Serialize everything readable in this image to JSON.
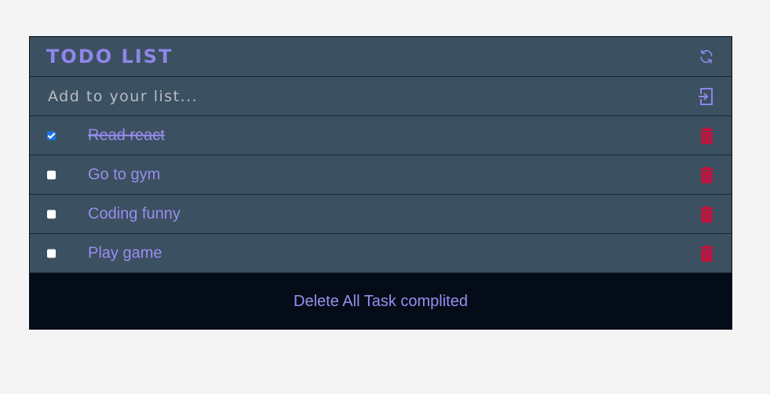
{
  "header": {
    "title": "TODO LIST",
    "refresh_icon": "refresh-icon"
  },
  "add_form": {
    "placeholder": "Add to your list...",
    "value": "",
    "submit_icon": "sign-in-icon"
  },
  "tasks": [
    {
      "label": "Read react",
      "completed": true
    },
    {
      "label": "Go to gym",
      "completed": false
    },
    {
      "label": "Coding funny",
      "completed": false
    },
    {
      "label": "Play game",
      "completed": false
    }
  ],
  "footer": {
    "delete_label": "Delete All Task complited"
  },
  "colors": {
    "accent": "#8e86ea",
    "task_text": "#9a8ef0",
    "card_bg": "#3b5060",
    "footer_bg": "#040c17",
    "trash": "#c4123d",
    "checkbox_checked": "#1a73e8"
  }
}
